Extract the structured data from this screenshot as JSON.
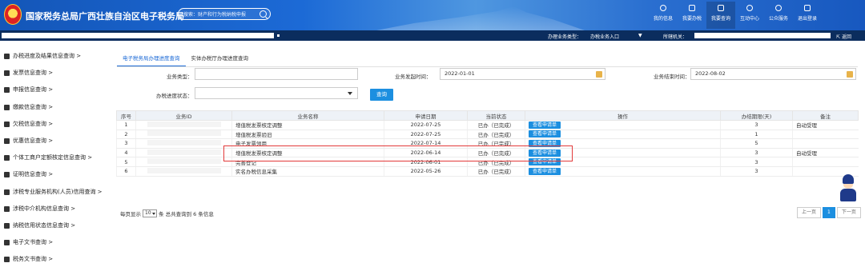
{
  "header": {
    "site_title": "国家税务总局广西壮族自治区电子税务局",
    "search_placeholder": "搜索：财产和行为税纳税申报",
    "nav": [
      {
        "label": "我的信息",
        "icon": "user-icon"
      },
      {
        "label": "我要办税",
        "icon": "monitor-icon"
      },
      {
        "label": "我要查询",
        "icon": "chart-icon"
      },
      {
        "label": "互动中心",
        "icon": "chat-icon"
      },
      {
        "label": "公众服务",
        "icon": "service-icon"
      },
      {
        "label": "退出登录",
        "icon": "logout-icon"
      }
    ]
  },
  "bar": {
    "identity_label": "办理业务类型：",
    "identity_value": "办税业务入口",
    "org_label": "所辖机关：",
    "back_label": "返回"
  },
  "sidebar": {
    "items": [
      {
        "label": "办税进度及结果信息查询 >",
        "icon": "progress-icon"
      },
      {
        "label": "发票信息查询 >",
        "icon": "invoice-icon"
      },
      {
        "label": "申报信息查询 >",
        "icon": "declare-icon"
      },
      {
        "label": "缴款信息查询 >",
        "icon": "payment-icon"
      },
      {
        "label": "欠税信息查询 >",
        "icon": "arrears-icon"
      },
      {
        "label": "优惠信息查询 >",
        "icon": "discount-icon"
      },
      {
        "label": "个体工商户定额核定信息查询 >",
        "icon": "quota-icon"
      },
      {
        "label": "证明信息查询 >",
        "icon": "certificate-icon"
      },
      {
        "label": "涉税专业服务机构(人员)信用查询 >",
        "icon": "credit-icon"
      },
      {
        "label": "涉税中介机构信息查询 >",
        "icon": "agency-icon"
      },
      {
        "label": "纳税信用状态信息查询 >",
        "icon": "status-icon"
      },
      {
        "label": "电子文书查询 >",
        "icon": "document-icon"
      },
      {
        "label": "税务文书查询 >",
        "icon": "tax-document-icon"
      }
    ]
  },
  "tabs": [
    {
      "label": "电子税务局办理进度查询",
      "active": true
    },
    {
      "label": "实体办税厅办理进度查询",
      "active": false
    }
  ],
  "form": {
    "biz_type_label": "业务类型：",
    "biz_type_value": "",
    "start_label": "业务发起时间：",
    "start_value": "2022-01-01",
    "end_label": "业务结束时间：",
    "end_value": "2022-08-02",
    "progress_label": "办税进度状态：",
    "progress_value": "",
    "query_button": "查询"
  },
  "table": {
    "columns": [
      "序号",
      "业务ID",
      "业务名称",
      "申请日期",
      "当前状态",
      "操作",
      "办结期限(天)",
      "备注"
    ],
    "rows": [
      {
        "no": "1",
        "id": "",
        "name": "增值税发票核定调整",
        "date": "2022-07-25",
        "status": "已办（已完成）",
        "action": "查看申请单",
        "days": "3",
        "note": "自动受理"
      },
      {
        "no": "2",
        "id": "",
        "name": "增值税发票验旧",
        "date": "2022-07-25",
        "status": "已办（已完成）",
        "action": "查看申请单",
        "days": "1",
        "note": ""
      },
      {
        "no": "3",
        "id": "",
        "name": "电子发票领用",
        "date": "2022-07-14",
        "status": "已办（已完成）",
        "action": "查看申请单",
        "days": "5",
        "note": ""
      },
      {
        "no": "4",
        "id": "",
        "name": "增值税发票核定调整",
        "date": "2022-06-14",
        "status": "已办（已完成）",
        "action": "查看申请单",
        "days": "3",
        "note": "自动受理"
      },
      {
        "no": "5",
        "id": "",
        "name": "完善登记",
        "date": "2022-06-01",
        "status": "已办（已完成）",
        "action": "查看申请单",
        "days": "3",
        "note": ""
      },
      {
        "no": "6",
        "id": "",
        "name": "实名办税信息采集",
        "date": "2022-05-26",
        "status": "已办（已完成）",
        "action": "查看申请单",
        "days": "3",
        "note": ""
      }
    ]
  },
  "pagination": {
    "prefix": "每页显示",
    "page_size": "10",
    "suffix": "条  总共查询到 6 条信息",
    "prev": "上一页",
    "current": "1",
    "next": "下一页"
  }
}
